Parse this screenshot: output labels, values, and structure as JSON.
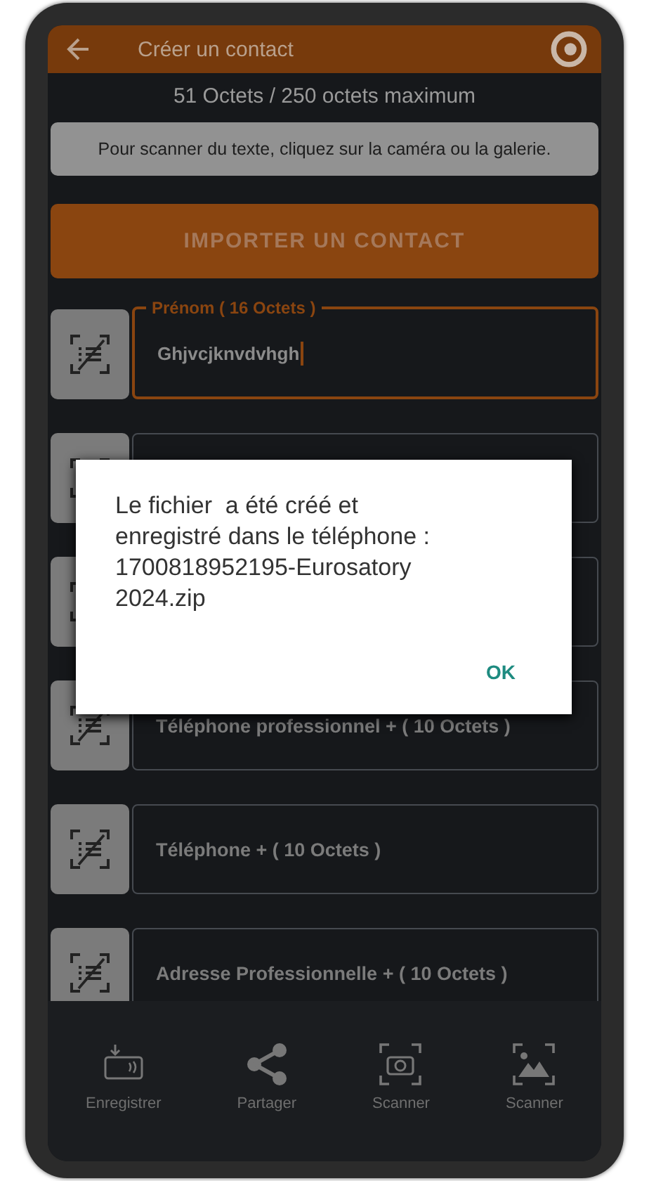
{
  "app_bar": {
    "title": "Créer un contact"
  },
  "byte_counter": "51 Octets / 250 octets maximum",
  "hint": "Pour scanner du texte, cliquez sur la caméra ou la galerie.",
  "import_button": "IMPORTER UN CONTACT",
  "fields": [
    {
      "label": "Prénom ( 16 Octets )",
      "value": "Ghjvcjknvdvhgh",
      "focused": true
    },
    {
      "focused": false
    },
    {
      "focused": false
    },
    {
      "placeholder": "Téléphone professionnel + ( 10 Octets )",
      "focused": false
    },
    {
      "placeholder": "Téléphone  + ( 10 Octets )",
      "focused": false
    },
    {
      "placeholder": "Adresse Professionnelle + ( 10 Octets )",
      "focused": false
    }
  ],
  "bottom_nav": [
    {
      "kind": "nfc",
      "label": "Enregistrer"
    },
    {
      "kind": "share",
      "label": "Partager"
    },
    {
      "kind": "camera",
      "label": "Scanner"
    },
    {
      "kind": "gallery",
      "label": "Scanner"
    }
  ],
  "dialog": {
    "message": "Le fichier  a été créé et enregistré dans le téléphone : 1700818952195-Eurosatory 2024.zip",
    "button": "OK"
  }
}
